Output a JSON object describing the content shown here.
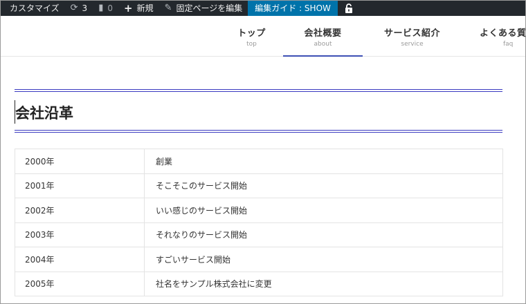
{
  "adminbar": {
    "customize": "カスタマイズ",
    "updates_count": "3",
    "comments_count": "0",
    "new_label": "新規",
    "edit_page": "固定ページを編集",
    "edit_guide": "編集ガイド : SHOW"
  },
  "nav": {
    "items": [
      {
        "label": "トップ",
        "sub": "top"
      },
      {
        "label": "会社概要",
        "sub": "about"
      },
      {
        "label": "サービス紹介",
        "sub": "service"
      },
      {
        "label": "よくある質",
        "sub": "faq"
      }
    ]
  },
  "page": {
    "title": "会社沿革"
  },
  "history": {
    "rows": [
      {
        "year": "2000年",
        "event": "創業"
      },
      {
        "year": "2001年",
        "event": "そこそこのサービス開始"
      },
      {
        "year": "2002年",
        "event": "いい感じのサービス開始"
      },
      {
        "year": "2003年",
        "event": "それなりのサービス開始"
      },
      {
        "year": "2004年",
        "event": "すごいサービス開始"
      },
      {
        "year": "2005年",
        "event": "社名をサンプル株式会社に変更"
      }
    ]
  },
  "colors": {
    "adminbar_bg": "#23282d",
    "active_bg": "#0073aa",
    "accent": "#3d4fb4"
  }
}
